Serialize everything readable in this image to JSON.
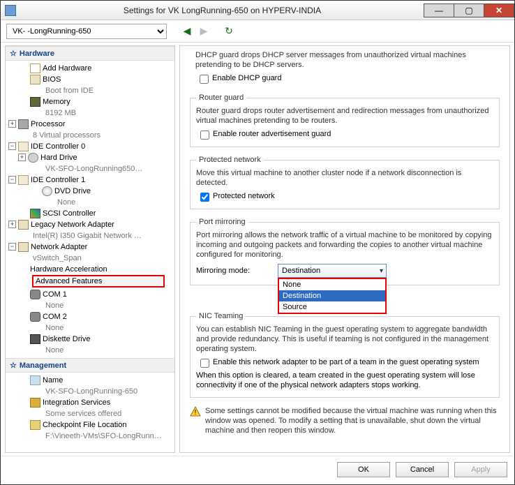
{
  "window": {
    "title": "Settings for VK       LongRunning-650 on HYPERV-INDIA"
  },
  "toolbar": {
    "vm_select": "VK-     -LongRunning-650"
  },
  "tree": {
    "hardware_label": "Hardware",
    "management_label": "Management",
    "add_hw": "Add Hardware",
    "bios": "BIOS",
    "bios_sub": "Boot from IDE",
    "mem": "Memory",
    "mem_sub": "8192 MB",
    "cpu": "Processor",
    "cpu_sub": "8 Virtual processors",
    "ide0": "IDE Controller 0",
    "hd": "Hard Drive",
    "hd_sub": "VK-SFO-LongRunning650…",
    "ide1": "IDE Controller 1",
    "dvd": "DVD Drive",
    "dvd_sub": "None",
    "scsi": "SCSI Controller",
    "lna": "Legacy Network Adapter",
    "lna_sub": "Intel(R) I350 Gigabit Network …",
    "na": "Network Adapter",
    "na_sub": "vSwitch_Span",
    "hwacc": "Hardware Acceleration",
    "advf": "Advanced Features",
    "com1": "COM 1",
    "com1_sub": "None",
    "com2": "COM 2",
    "com2_sub": "None",
    "dsk": "Diskette Drive",
    "dsk_sub": "None",
    "name": "Name",
    "name_sub": "VK-SFO-LongRunning-650",
    "svc": "Integration Services",
    "svc_sub": "Some services offered",
    "chk": "Checkpoint File Location",
    "chk_sub": "F:\\Vineeth-VMs\\SFO-LongRunn…"
  },
  "panel": {
    "dhcp_desc": "DHCP guard drops DHCP server messages from unauthorized virtual machines pretending to be DHCP servers.",
    "dhcp_chk": "Enable DHCP guard",
    "router_title": "Router guard",
    "router_desc": "Router guard drops router advertisement and redirection messages from unauthorized virtual machines pretending to be routers.",
    "router_chk": "Enable router advertisement guard",
    "prot_title": "Protected network",
    "prot_desc": "Move this virtual machine to another cluster node if a network disconnection is detected.",
    "prot_chk": "Protected network",
    "mirror_title": "Port mirroring",
    "mirror_desc": "Port mirroring allows the network traffic of a virtual machine to be monitored by copying incoming and outgoing packets and forwarding the copies to another virtual machine configured for monitoring.",
    "mirror_label": "Mirroring mode:",
    "mirror_selected": "Destination",
    "mirror_opts": {
      "o0": "None",
      "o1": "Destination",
      "o2": "Source"
    },
    "nic_title": "NIC Teaming",
    "nic_desc": "You can establish NIC Teaming in the guest operating system to aggregate bandwidth and provide redundancy. This is useful if teaming is not configured in the management operating system.",
    "nic_chk": "Enable this network adapter to be part of a team in the guest operating system",
    "nic_note": "When this option is cleared, a team created in the guest operating system will lose connectivity if one of the physical network adapters stops working.",
    "warn": "Some settings cannot be modified because the virtual machine was running when this window was opened. To modify a setting that is unavailable, shut down the virtual machine and then reopen this window."
  },
  "buttons": {
    "ok": "OK",
    "cancel": "Cancel",
    "apply": "Apply"
  }
}
